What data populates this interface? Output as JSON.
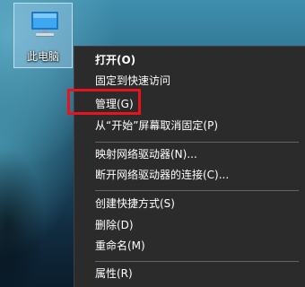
{
  "desktop": {
    "icon": {
      "name": "this-pc-icon",
      "label": "此电脑"
    }
  },
  "context_menu": {
    "items": [
      {
        "label": "打开(O)",
        "bold": true
      },
      {
        "label": "固定到快速访问"
      },
      {
        "label": "管理(G)"
      },
      {
        "label": "从“开始”屏幕取消固定(P)"
      },
      {
        "label": "映射网络驱动器(N)..."
      },
      {
        "label": "断开网络驱动器的连接(C)..."
      },
      {
        "label": "创建快捷方式(S)"
      },
      {
        "label": "删除(D)"
      },
      {
        "label": "重命名(M)"
      },
      {
        "label": "属性(R)"
      }
    ]
  },
  "annotation": {
    "highlight_color": "#e8131c",
    "highlighted_item": "管理(G)"
  },
  "colors": {
    "menu_background": "#2b2b2b",
    "menu_text": "#ffffff",
    "separator": "#646464"
  }
}
